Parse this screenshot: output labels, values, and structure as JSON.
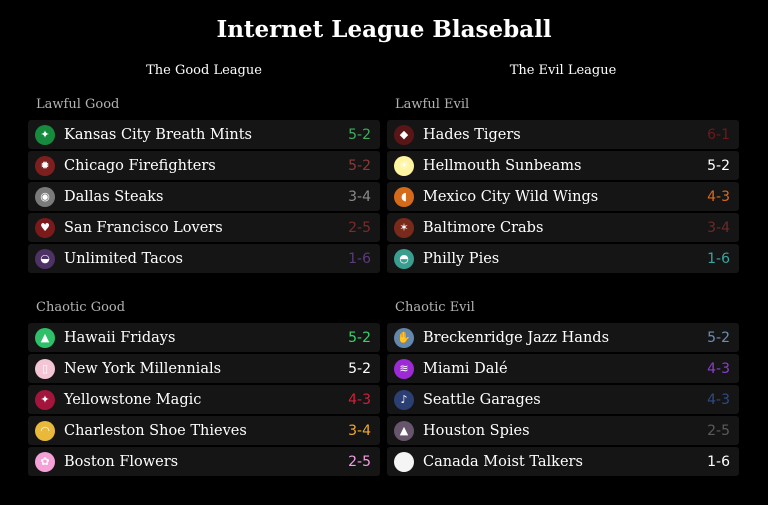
{
  "title": "Internet League Blaseball",
  "leagues": [
    {
      "name": "The Good League",
      "divisions": [
        {
          "name": "Lawful Good",
          "teams": [
            {
              "name": "Kansas City Breath Mints",
              "record": "5-2",
              "record_color": "#3fae5a",
              "icon_bg": "#168b3e",
              "icon": "breath-mint-icon",
              "glyph": "✦"
            },
            {
              "name": "Chicago Firefighters",
              "record": "5-2",
              "record_color": "#8a3a3a",
              "icon_bg": "#7d1f1f",
              "icon": "fire-icon",
              "glyph": "✹"
            },
            {
              "name": "Dallas Steaks",
              "record": "3-4",
              "record_color": "#8a8a8a",
              "icon_bg": "#7a7a7a",
              "icon": "steak-icon",
              "glyph": "◉"
            },
            {
              "name": "San Francisco Lovers",
              "record": "2-5",
              "record_color": "#7a2b2b",
              "icon_bg": "#7a1a1a",
              "icon": "kiss-icon",
              "glyph": "♥"
            },
            {
              "name": "Unlimited Tacos",
              "record": "1-6",
              "record_color": "#5b3b7a",
              "icon_bg": "#4d3266",
              "icon": "taco-icon",
              "glyph": "◒"
            }
          ]
        },
        {
          "name": "Chaotic Good",
          "teams": [
            {
              "name": "Hawaii Fridays",
              "record": "5-2",
              "record_color": "#35d36b",
              "icon_bg": "#2fc06a",
              "icon": "upload-arrow-icon",
              "glyph": "▲"
            },
            {
              "name": "New York Millennials",
              "record": "5-2",
              "record_color": "#ffffff",
              "icon_bg": "#f3c6d6",
              "icon": "phone-icon",
              "glyph": "▯"
            },
            {
              "name": "Yellowstone Magic",
              "record": "4-3",
              "record_color": "#d1203a",
              "icon_bg": "#a3153c",
              "icon": "sparkle-icon",
              "glyph": "✦"
            },
            {
              "name": "Charleston Shoe Thieves",
              "record": "3-4",
              "record_color": "#f0a930",
              "icon_bg": "#e8b93a",
              "icon": "shoe-icon",
              "glyph": "◠"
            },
            {
              "name": "Boston Flowers",
              "record": "2-5",
              "record_color": "#f29ee0",
              "icon_bg": "#f5a1d8",
              "icon": "flower-icon",
              "glyph": "✿"
            }
          ]
        }
      ]
    },
    {
      "name": "The Evil League",
      "divisions": [
        {
          "name": "Lawful Evil",
          "teams": [
            {
              "name": "Hades Tigers",
              "record": "6-1",
              "record_color": "#6b1a1a",
              "icon_bg": "#5a1616",
              "icon": "tiger-icon",
              "glyph": "◆"
            },
            {
              "name": "Hellmouth Sunbeams",
              "record": "5-2",
              "record_color": "#ffffff",
              "icon_bg": "#fff5a0",
              "icon": "sun-icon",
              "glyph": "☀"
            },
            {
              "name": "Mexico City Wild Wings",
              "record": "4-3",
              "record_color": "#d96a1c",
              "icon_bg": "#d46a1a",
              "icon": "chicken-wing-icon",
              "glyph": "◖"
            },
            {
              "name": "Baltimore Crabs",
              "record": "3-4",
              "record_color": "#6b2a2a",
              "icon_bg": "#7a2a1a",
              "icon": "crab-icon",
              "glyph": "✶"
            },
            {
              "name": "Philly Pies",
              "record": "1-6",
              "record_color": "#39a6a0",
              "icon_bg": "#399d8f",
              "icon": "pie-icon",
              "glyph": "◓"
            }
          ]
        },
        {
          "name": "Chaotic Evil",
          "teams": [
            {
              "name": "Breckenridge Jazz Hands",
              "record": "5-2",
              "record_color": "#6b8fb5",
              "icon_bg": "#6388ad",
              "icon": "jazz-hands-icon",
              "glyph": "✋"
            },
            {
              "name": "Miami Dalé",
              "record": "4-3",
              "record_color": "#8a3fc9",
              "icon_bg": "#9c2bd6",
              "icon": "waves-icon",
              "glyph": "≋"
            },
            {
              "name": "Seattle Garages",
              "record": "4-3",
              "record_color": "#2f4a80",
              "icon_bg": "#2b3f73",
              "icon": "guitar-icon",
              "glyph": "♪"
            },
            {
              "name": "Houston Spies",
              "record": "2-5",
              "record_color": "#5a5a5a",
              "icon_bg": "#67556b",
              "icon": "spy-icon",
              "glyph": "▲"
            },
            {
              "name": "Canada Moist Talkers",
              "record": "1-6",
              "record_color": "#ffffff",
              "icon_bg": "#f5f5f5",
              "icon": "blank-icon",
              "glyph": ""
            }
          ]
        }
      ]
    }
  ]
}
